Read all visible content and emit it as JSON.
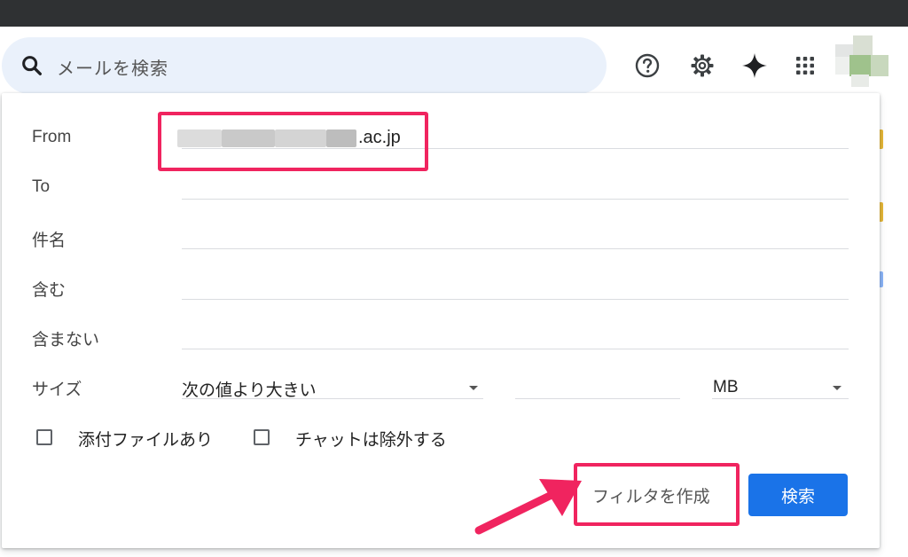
{
  "search": {
    "placeholder": "メールを検索"
  },
  "icons": {
    "search": "search-icon",
    "help": "help-icon",
    "settings": "gear-icon",
    "gemini": "sparkle-icon",
    "apps": "apps-grid-icon"
  },
  "filter_form": {
    "from_label": "From",
    "from_value_suffix": ".ac.jp",
    "to_label": "To",
    "subject_label": "件名",
    "has_words_label": "含む",
    "doesnt_have_label": "含まない",
    "size_label": "サイズ",
    "size_operator": "次の値より大きい",
    "size_unit": "MB",
    "has_attachment_label": "添付ファイルあり",
    "exclude_chats_label": "チャットは除外する",
    "create_filter_label": "フィルタを作成",
    "search_button_label": "検索"
  },
  "colors": {
    "highlight": "#f0245f",
    "primary_button": "#1a73e8",
    "search_bg": "#eaf1fb",
    "topbar": "#2f3133"
  }
}
